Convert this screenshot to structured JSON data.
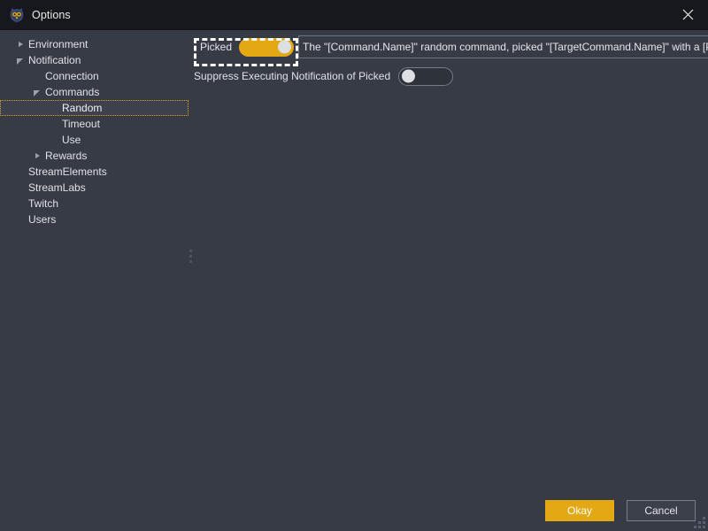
{
  "window": {
    "title": "Options",
    "icon": "owl-logo-icon",
    "close_icon": "close-icon"
  },
  "sidebar": {
    "items": [
      {
        "label": "Environment",
        "level": 0,
        "state": "collapsed",
        "selected": false
      },
      {
        "label": "Notification",
        "level": 0,
        "state": "expanded",
        "selected": false
      },
      {
        "label": "Connection",
        "level": 1,
        "state": "leaf",
        "selected": false
      },
      {
        "label": "Commands",
        "level": 1,
        "state": "expanded",
        "selected": false
      },
      {
        "label": "Random",
        "level": 2,
        "state": "leaf",
        "selected": true
      },
      {
        "label": "Timeout",
        "level": 2,
        "state": "leaf",
        "selected": false
      },
      {
        "label": "Use",
        "level": 2,
        "state": "leaf",
        "selected": false
      },
      {
        "label": "Rewards",
        "level": 1,
        "state": "collapsed",
        "selected": false
      },
      {
        "label": "StreamElements",
        "level": 0,
        "state": "leaf",
        "selected": false
      },
      {
        "label": "StreamLabs",
        "level": 0,
        "state": "leaf",
        "selected": false
      },
      {
        "label": "Twitch",
        "level": 0,
        "state": "leaf",
        "selected": false
      },
      {
        "label": "Users",
        "level": 0,
        "state": "leaf",
        "selected": false
      }
    ]
  },
  "main": {
    "picked": {
      "label": "Picked",
      "toggle_state": "on",
      "message_value": "The \"[Command.Name]\" random command, picked \"[TargetCommand.Name]\" with a [Percen"
    },
    "suppress": {
      "label": "Suppress Executing Notification of Picked",
      "toggle_state": "off"
    }
  },
  "footer": {
    "okay_label": "Okay",
    "cancel_label": "Cancel"
  },
  "colors": {
    "accent": "#e3a813",
    "background": "#373b45",
    "titlebar": "#16181d",
    "focus_outline": "#ffffff",
    "tree_selection": "#d9a22b"
  }
}
